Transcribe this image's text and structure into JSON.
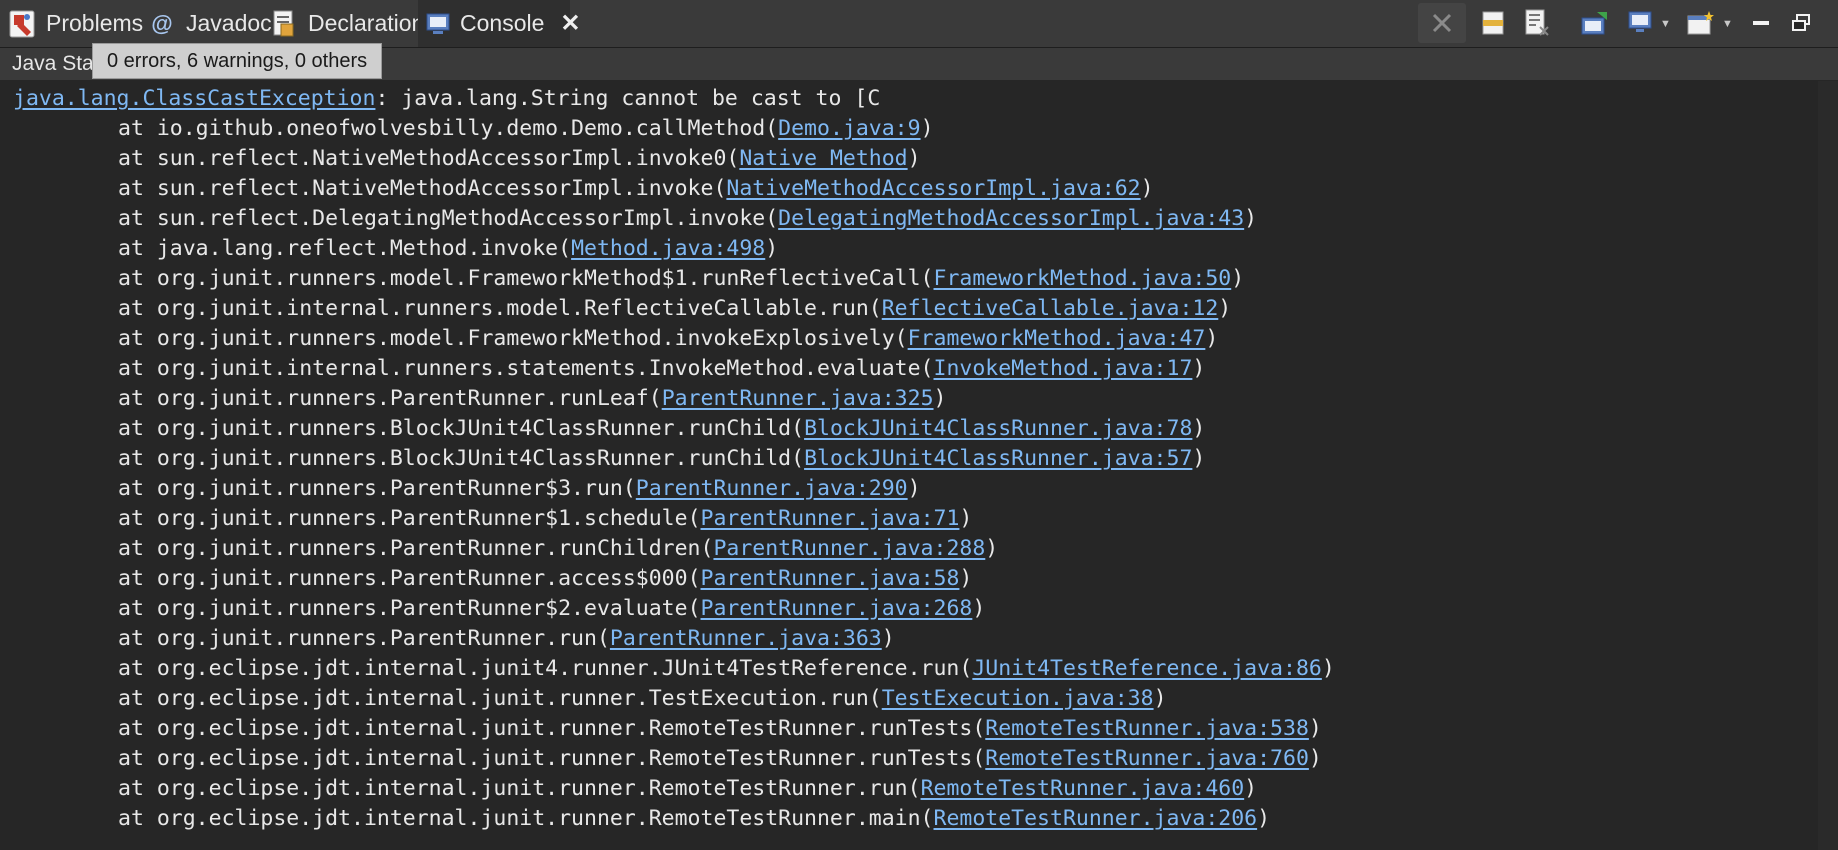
{
  "tabs": [
    {
      "label": "Problems",
      "icon": "problems-icon"
    },
    {
      "label": "Javadoc",
      "icon": "javadoc-at-icon"
    },
    {
      "label": "Declaration",
      "icon": "declaration-icon"
    },
    {
      "label": "Console",
      "icon": "console-icon",
      "active": true
    }
  ],
  "toolbar": {
    "icons": [
      "remove-launch-icon",
      "clear-console-icon",
      "scroll-lock-icon",
      "pin-console-icon",
      "display-selected-console-icon",
      "open-console-icon",
      "minimize-icon",
      "maximize-icon"
    ]
  },
  "info": {
    "label_visible": "Java Sta",
    "tooltip": "0 errors, 6 warnings, 0 others"
  },
  "console": {
    "exception_class": "java.lang.ClassCastException",
    "exception_message": ": java.lang.String cannot be cast to [C",
    "frames": [
      {
        "method": "io.github.oneofwolvesbilly.demo.Demo.callMethod",
        "link": "Demo.java:9"
      },
      {
        "method": "sun.reflect.NativeMethodAccessorImpl.invoke0",
        "link": "Native Method"
      },
      {
        "method": "sun.reflect.NativeMethodAccessorImpl.invoke",
        "link": "NativeMethodAccessorImpl.java:62"
      },
      {
        "method": "sun.reflect.DelegatingMethodAccessorImpl.invoke",
        "link": "DelegatingMethodAccessorImpl.java:43"
      },
      {
        "method": "java.lang.reflect.Method.invoke",
        "link": "Method.java:498"
      },
      {
        "method": "org.junit.runners.model.FrameworkMethod$1.runReflectiveCall",
        "link": "FrameworkMethod.java:50"
      },
      {
        "method": "org.junit.internal.runners.model.ReflectiveCallable.run",
        "link": "ReflectiveCallable.java:12"
      },
      {
        "method": "org.junit.runners.model.FrameworkMethod.invokeExplosively",
        "link": "FrameworkMethod.java:47"
      },
      {
        "method": "org.junit.internal.runners.statements.InvokeMethod.evaluate",
        "link": "InvokeMethod.java:17"
      },
      {
        "method": "org.junit.runners.ParentRunner.runLeaf",
        "link": "ParentRunner.java:325"
      },
      {
        "method": "org.junit.runners.BlockJUnit4ClassRunner.runChild",
        "link": "BlockJUnit4ClassRunner.java:78"
      },
      {
        "method": "org.junit.runners.BlockJUnit4ClassRunner.runChild",
        "link": "BlockJUnit4ClassRunner.java:57"
      },
      {
        "method": "org.junit.runners.ParentRunner$3.run",
        "link": "ParentRunner.java:290"
      },
      {
        "method": "org.junit.runners.ParentRunner$1.schedule",
        "link": "ParentRunner.java:71"
      },
      {
        "method": "org.junit.runners.ParentRunner.runChildren",
        "link": "ParentRunner.java:288"
      },
      {
        "method": "org.junit.runners.ParentRunner.access$000",
        "link": "ParentRunner.java:58"
      },
      {
        "method": "org.junit.runners.ParentRunner$2.evaluate",
        "link": "ParentRunner.java:268"
      },
      {
        "method": "org.junit.runners.ParentRunner.run",
        "link": "ParentRunner.java:363"
      },
      {
        "method": "org.eclipse.jdt.internal.junit4.runner.JUnit4TestReference.run",
        "link": "JUnit4TestReference.java:86"
      },
      {
        "method": "org.eclipse.jdt.internal.junit.runner.TestExecution.run",
        "link": "TestExecution.java:38"
      },
      {
        "method": "org.eclipse.jdt.internal.junit.runner.RemoteTestRunner.runTests",
        "link": "RemoteTestRunner.java:538"
      },
      {
        "method": "org.eclipse.jdt.internal.junit.runner.RemoteTestRunner.runTests",
        "link": "RemoteTestRunner.java:760"
      },
      {
        "method": "org.eclipse.jdt.internal.junit.runner.RemoteTestRunner.run",
        "link": "RemoteTestRunner.java:460"
      },
      {
        "method": "org.eclipse.jdt.internal.junit.runner.RemoteTestRunner.main",
        "link": "RemoteTestRunner.java:206"
      }
    ]
  },
  "colors": {
    "background": "#262626",
    "text": "#e8e8e8",
    "link": "#7fb8f3",
    "tabbar": "#3a3a3a"
  }
}
